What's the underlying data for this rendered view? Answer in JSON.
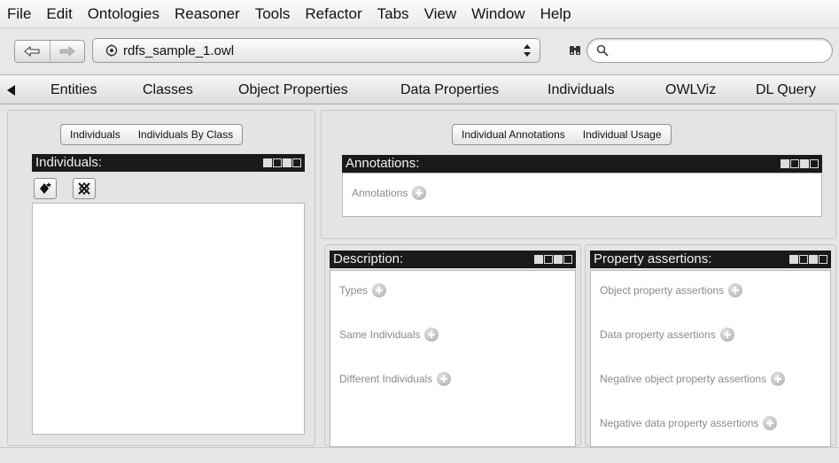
{
  "menu": [
    "File",
    "Edit",
    "Ontologies",
    "Reasoner",
    "Tools",
    "Refactor",
    "Tabs",
    "View",
    "Window",
    "Help"
  ],
  "toolbar": {
    "back_icon": "back-arrow-icon",
    "forward_icon": "forward-arrow-icon",
    "ontology_icon": "ontology-icon",
    "ontology_name": "rdfs_sample_1.owl",
    "find_icon": "binoculars-icon",
    "search_icon": "search-icon",
    "search_value": ""
  },
  "tabs": [
    "Entities",
    "Classes",
    "Object Properties",
    "Data Properties",
    "Individuals",
    "OWLViz",
    "DL Query"
  ],
  "left_panel": {
    "segmented": [
      "Individuals",
      "Individuals By Class"
    ],
    "header": "Individuals:",
    "add_icon": "add-individual-icon",
    "delete_icon": "delete-individual-icon"
  },
  "right_top": {
    "segmented": [
      "Individual Annotations",
      "Individual Usage"
    ],
    "annotations_header": "Annotations:",
    "annotations_label": "Annotations"
  },
  "description": {
    "header": "Description:",
    "sections": [
      "Types",
      "Same Individuals",
      "Different Individuals"
    ]
  },
  "property_assertions": {
    "header": "Property assertions:",
    "sections": [
      "Object property assertions",
      "Data property assertions",
      "Negative object property assertions",
      "Negative data property assertions"
    ]
  },
  "colors": {
    "header_bg": "#1a1a1a",
    "header_text": "#f2f2f2",
    "window_bg": "#e6e6e6",
    "muted_text": "#8a8a8a"
  }
}
